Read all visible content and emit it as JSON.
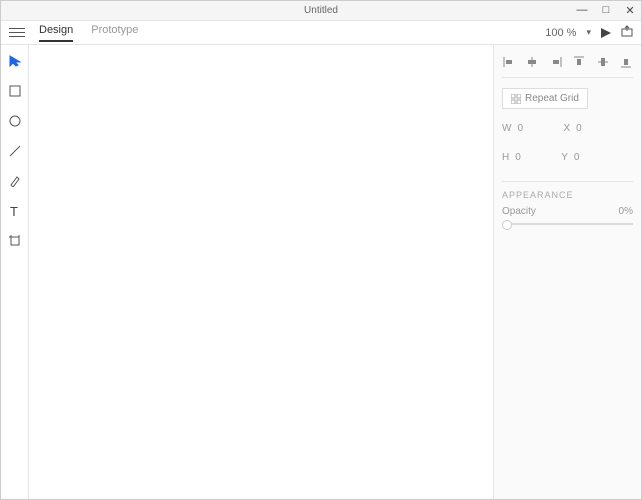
{
  "titlebar": {
    "title": "Untitled"
  },
  "tabs": {
    "design": "Design",
    "prototype": "Prototype"
  },
  "zoom": {
    "value": "100 %"
  },
  "panel": {
    "repeat_grid": "Repeat Grid",
    "w_label": "W",
    "w_val": "0",
    "x_label": "X",
    "x_val": "0",
    "h_label": "H",
    "h_val": "0",
    "y_label": "Y",
    "y_val": "0",
    "appearance": "APPEARANCE",
    "opacity_label": "Opacity",
    "opacity_val": "0%"
  }
}
